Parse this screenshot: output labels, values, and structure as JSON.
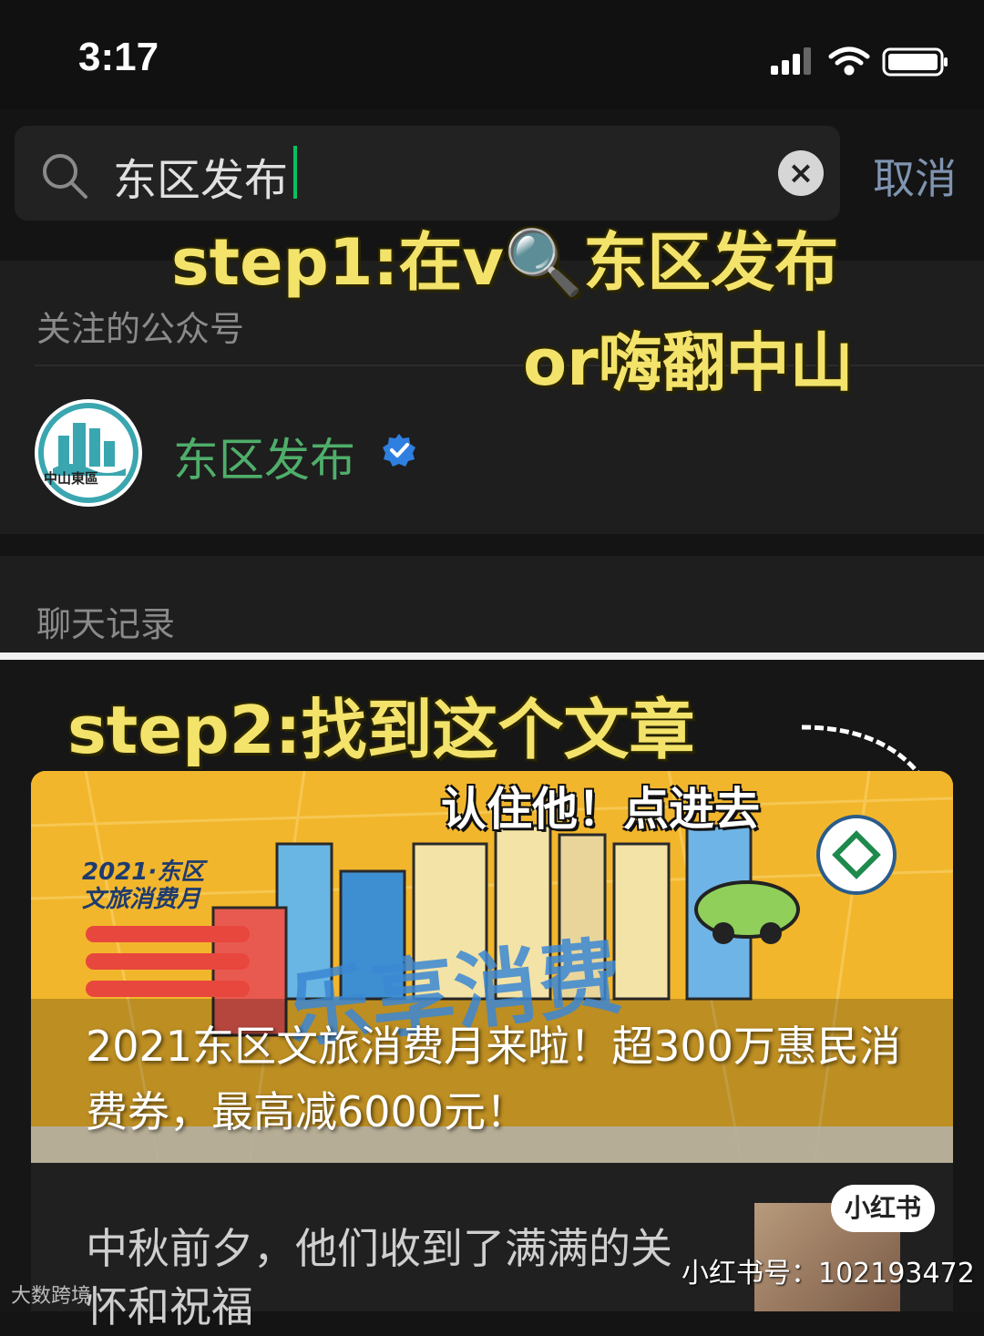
{
  "status_bar": {
    "time": "3:17"
  },
  "search": {
    "query": "东区发布",
    "cancel_label": "取消"
  },
  "sections": {
    "accounts_label": "关注的公众号",
    "chat_label": "聊天记录"
  },
  "account": {
    "name": "东区发布",
    "avatar_text": "中山東區",
    "verified": true
  },
  "overlay": {
    "step1_line1": "step1:在v🔍东区发布",
    "step1_line2": "or嗨翻中山",
    "step2": "step2:找到这个文章",
    "hint": "认住他！点进去"
  },
  "article": {
    "banner_line1": "2021·东区",
    "banner_line2": "文旅消费月",
    "banner_big": "乐享消费",
    "title": "2021东区文旅消费月来啦！超300万惠民消费券，最高减6000元！",
    "snippet": "中秋前夕，他们收到了满满的关怀和祝福"
  },
  "watermark": {
    "badge": "小红书",
    "id": "小红书号：102193472",
    "source": "大数跨境"
  },
  "colors": {
    "accent_green": "#07c160",
    "step_yellow": "#f3e36b",
    "card_orange": "#f2b62c"
  }
}
